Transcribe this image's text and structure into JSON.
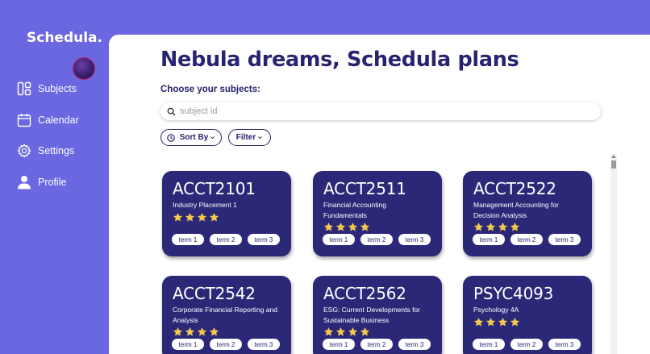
{
  "app": {
    "logo_text": "Schedula."
  },
  "sidebar": {
    "items": [
      {
        "label": "Subjects",
        "icon": "layout-icon"
      },
      {
        "label": "Calendar",
        "icon": "calendar-icon"
      },
      {
        "label": "Settings",
        "icon": "gear-icon"
      },
      {
        "label": "Profile",
        "icon": "user-icon"
      }
    ]
  },
  "main": {
    "title": "Nebula dreams, Schedula plans",
    "subtitle": "Choose your subjects:",
    "search": {
      "placeholder": "subject id",
      "value": ""
    },
    "sort_label": "Sort By",
    "filter_label": "Filter"
  },
  "subjects": [
    {
      "code": "ACCT2101",
      "name": "Industry Placement 1",
      "rating": 4,
      "terms": [
        "term 1",
        "term 2",
        "term 3"
      ]
    },
    {
      "code": "ACCT2511",
      "name": "Financial Accounting Fundamentals",
      "rating": 4,
      "terms": [
        "term 1",
        "term 2",
        "term 3"
      ]
    },
    {
      "code": "ACCT2522",
      "name": "Management Accounting for Decision Analysis",
      "rating": 4,
      "terms": [
        "term 1",
        "term 2",
        "term 3"
      ]
    },
    {
      "code": "ACCT2542",
      "name": "Corporate Financial Reporting and Analysis",
      "rating": 4,
      "terms": [
        "term 1",
        "term 2",
        "term 3"
      ]
    },
    {
      "code": "ACCT2562",
      "name": "ESG: Current Developments for Sustainable Business",
      "rating": 4,
      "terms": [
        "term 1",
        "term 2",
        "term 3"
      ]
    },
    {
      "code": "PSYC4093",
      "name": "Psychology 4A",
      "rating": 4,
      "terms": [
        "term 1",
        "term 2",
        "term 3"
      ]
    }
  ],
  "colors": {
    "sidebar_bg": "#6a67e0",
    "card_bg": "#2c2878",
    "title": "#262470",
    "star": "#f2c94c"
  }
}
